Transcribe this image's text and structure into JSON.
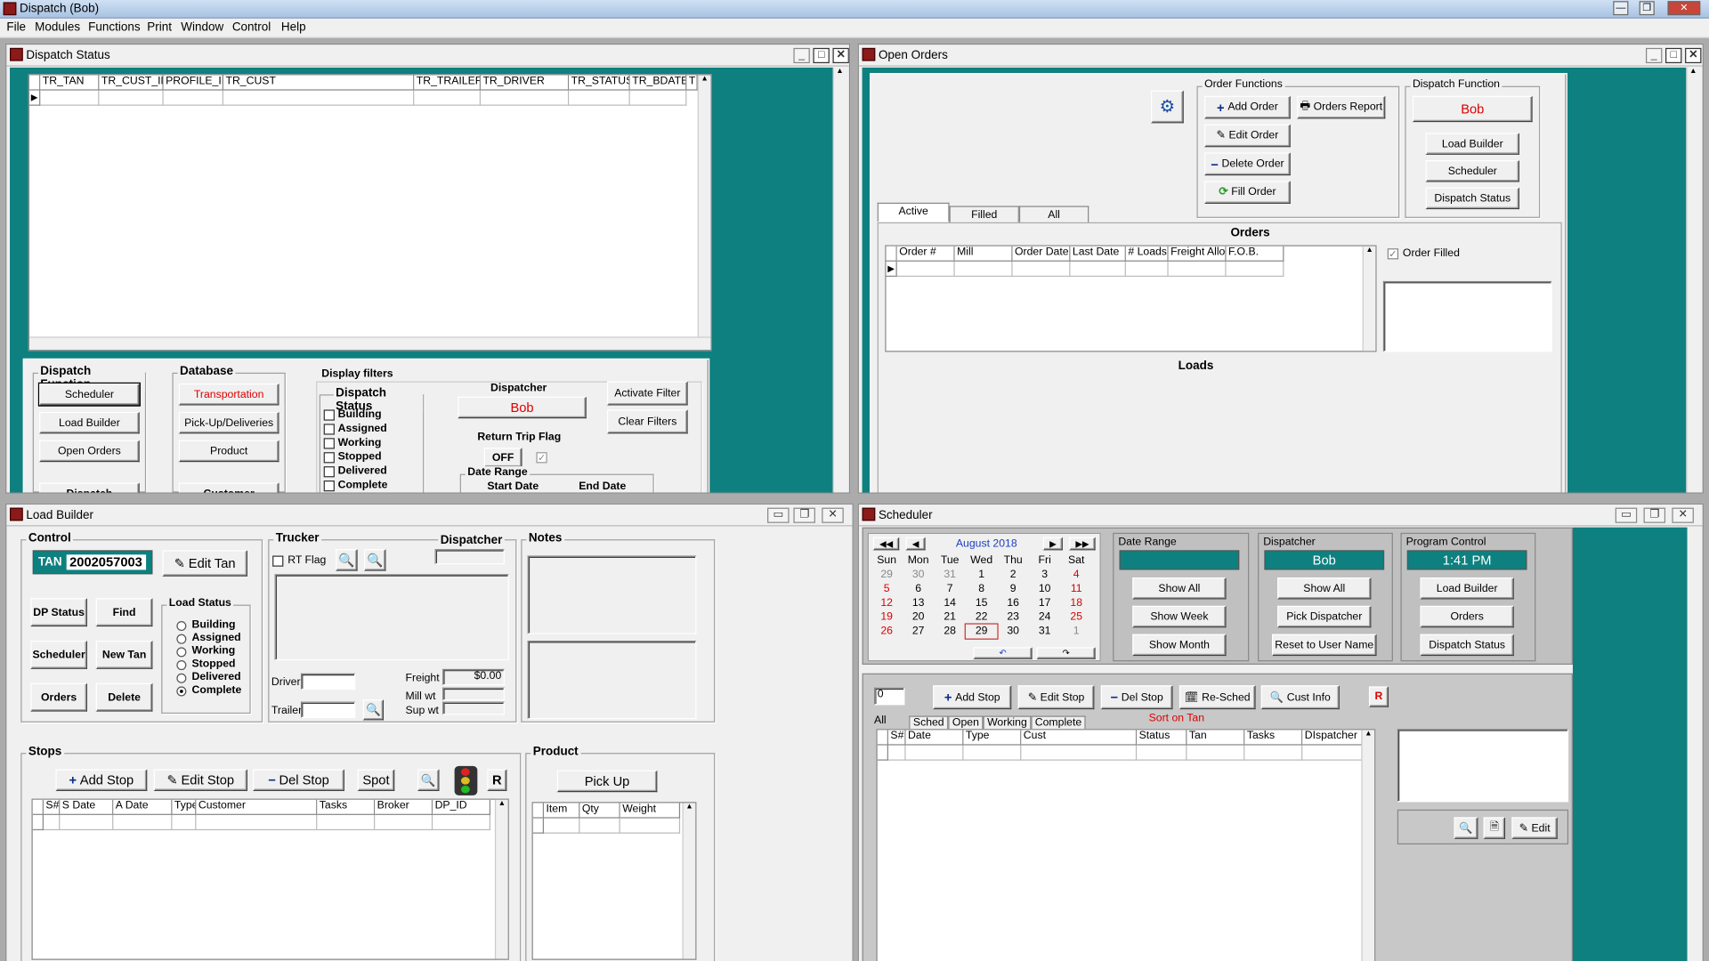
{
  "app": {
    "title": "Dispatch (Bob)",
    "menu": [
      "File",
      "Modules",
      "Functions",
      "Print",
      "Window",
      "Control",
      "Help"
    ]
  },
  "dispatch_status": {
    "title": "Dispatch Status",
    "columns": [
      "TR_TAN",
      "TR_CUST_ID",
      "PROFILE_ID",
      "TR_CUST",
      "TR_TRAILER",
      "TR_DRIVER",
      "TR_STATUS",
      "TR_BDATE",
      "T"
    ],
    "dispatch_function": {
      "label": "Dispatch Function",
      "buttons": [
        "Scheduler",
        "Load Builder",
        "Open Orders",
        "Dispatch"
      ]
    },
    "database": {
      "label": "Database",
      "buttons": [
        "Transportation",
        "Pick-Up/Deliveries",
        "Product",
        "Customer"
      ]
    },
    "display_filters": "Display filters",
    "status_group": {
      "label": "Dispatch Status",
      "items": [
        "Building",
        "Assigned",
        "Working",
        "Stopped",
        "Delivered",
        "Complete"
      ]
    },
    "dispatcher_label": "Dispatcher",
    "dispatcher": "Bob",
    "return_trip_label": "Return Trip Flag",
    "return_trip_value": "OFF",
    "activate_filter": "Activate Filter",
    "clear_filters": "Clear Filters",
    "date_range": "Date Range",
    "start_date": "Start Date",
    "end_date": "End Date"
  },
  "open_orders": {
    "title": "Open Orders",
    "order_functions": {
      "label": "Order Functions",
      "add": "Add Order",
      "report": "Orders Report",
      "edit": "Edit Order",
      "delete": "Delete Order",
      "fill": "Fill Order"
    },
    "dispatch_function": {
      "label": "Dispatch Function",
      "user": "Bob",
      "buttons": [
        "Load Builder",
        "Scheduler",
        "Dispatch Status"
      ]
    },
    "tabs": [
      "Active",
      "Filled",
      "All"
    ],
    "orders_label": "Orders",
    "columns": [
      "Order #",
      "Mill",
      "Order Date",
      "Last Date",
      "# Loads",
      "Freight Allow",
      "F.O.B."
    ],
    "order_filled": "Order Filled",
    "loads_label": "Loads"
  },
  "load_builder": {
    "title": "Load Builder",
    "control_label": "Control",
    "tan_label": "TAN",
    "tan_value": "2002057003",
    "edit_tan": "Edit Tan",
    "buttons": [
      "DP Status",
      "Find",
      "Scheduler",
      "New Tan",
      "Orders",
      "Delete"
    ],
    "load_status": {
      "label": "Load Status",
      "items": [
        "Building",
        "Assigned",
        "Working",
        "Stopped",
        "Delivered",
        "Complete"
      ],
      "selected": "Complete"
    },
    "trucker_label": "Trucker",
    "rt_flag": "RT Flag",
    "dispatcher_label": "Dispatcher",
    "notes_label": "Notes",
    "driver_label": "Driver",
    "trailer_label": "Trailer",
    "freight_label": "Freight",
    "freight_value": "$0.00",
    "mill_wt": "Mill wt",
    "sup_wt": "Sup wt",
    "stops_label": "Stops",
    "add_stop": "Add Stop",
    "edit_stop": "Edit Stop",
    "del_stop": "Del Stop",
    "spot": "Spot",
    "r": "R",
    "stops_columns": [
      "S#",
      "S Date",
      "A Date",
      "Type",
      "Customer",
      "Tasks",
      "Broker",
      "DP_ID"
    ],
    "product_label": "Product",
    "pick_up": "Pick Up",
    "product_columns": [
      "Item",
      "Qty",
      "Weight"
    ]
  },
  "scheduler": {
    "title": "Scheduler",
    "calendar": {
      "month": "August 2018",
      "days": [
        "Sun",
        "Mon",
        "Tue",
        "Wed",
        "Thu",
        "Fri",
        "Sat"
      ],
      "weeks": [
        [
          "29",
          "30",
          "31",
          "1",
          "2",
          "3",
          "4"
        ],
        [
          "5",
          "6",
          "7",
          "8",
          "9",
          "10",
          "11"
        ],
        [
          "12",
          "13",
          "14",
          "15",
          "16",
          "17",
          "18"
        ],
        [
          "19",
          "20",
          "21",
          "22",
          "23",
          "24",
          "25"
        ],
        [
          "26",
          "27",
          "28",
          "29",
          "30",
          "31",
          "1"
        ]
      ]
    },
    "date_range": {
      "label": "Date Range",
      "buttons": [
        "Show All",
        "Show Week",
        "Show Month"
      ]
    },
    "dispatcher": {
      "label": "Dispatcher",
      "value": "Bob",
      "buttons": [
        "Show All",
        "Pick Dispatcher",
        "Reset to User Name"
      ]
    },
    "program_control": {
      "label": "Program Control",
      "time": "1:41 PM",
      "buttons": [
        "Load Builder",
        "Orders",
        "Dispatch Status"
      ]
    },
    "count": "0",
    "add_stop": "Add Stop",
    "edit_stop": "Edit Stop",
    "del_stop": "Del Stop",
    "resched": "Re-Sched",
    "cust_info": "Cust Info",
    "r": "R",
    "tabs": [
      "All",
      "Sched",
      "Open",
      "Working",
      "Complete"
    ],
    "sort": "Sort on Tan",
    "columns": [
      "S#",
      "Date",
      "Type",
      "Cust",
      "Status",
      "Tan",
      "Tasks",
      "DIspatcher"
    ],
    "edit": "Edit"
  }
}
